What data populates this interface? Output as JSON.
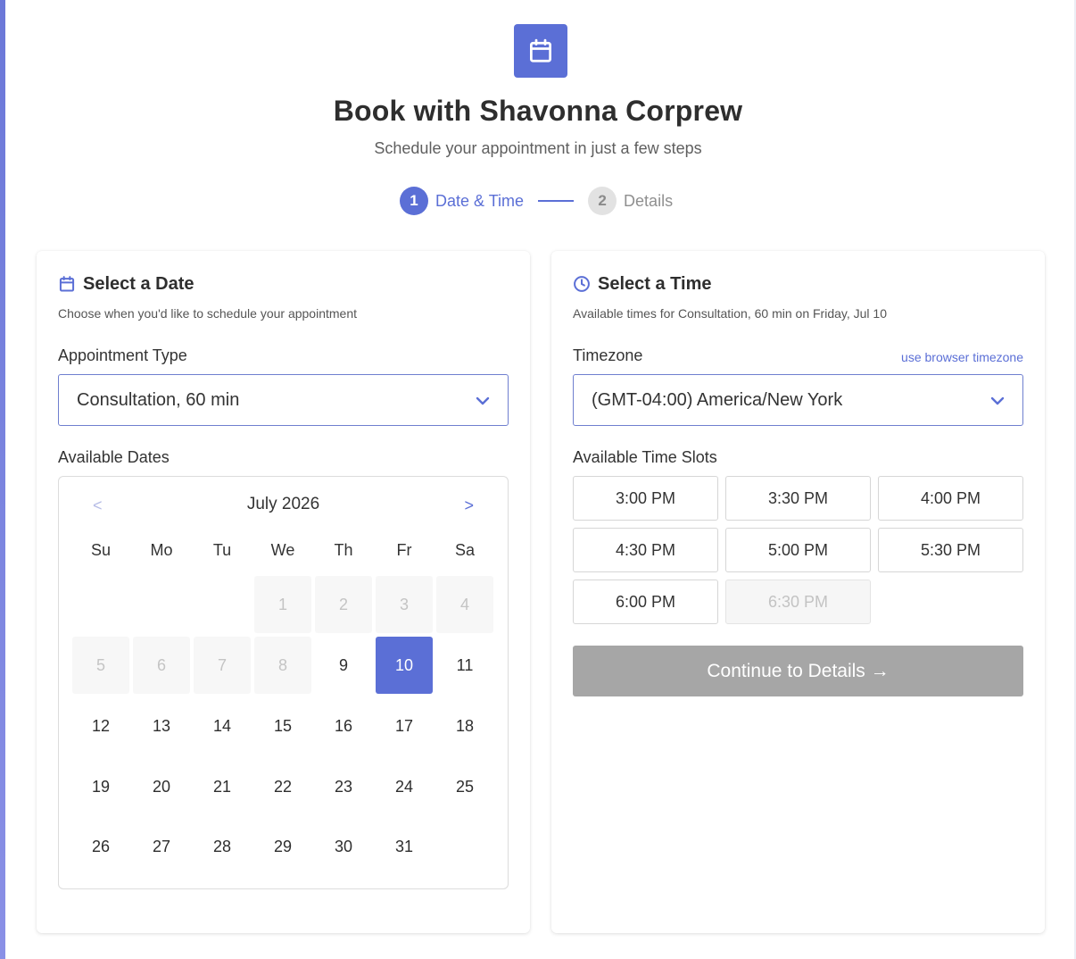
{
  "header": {
    "logo_icon": "calendar-icon",
    "title": "Book with Shavonna Corprew",
    "subtitle": "Schedule your appointment in just a few steps"
  },
  "steps": [
    {
      "number": "1",
      "label": "Date & Time",
      "state": "active"
    },
    {
      "number": "2",
      "label": "Details",
      "state": "inactive"
    }
  ],
  "date_card": {
    "title": "Select a Date",
    "description": "Choose when you'd like to schedule your appointment",
    "appointment_type_label": "Appointment Type",
    "appointment_type_value": "Consultation, 60 min",
    "available_dates_label": "Available Dates",
    "calendar": {
      "prev": "<",
      "next": ">",
      "month": "July 2026",
      "weekdays": [
        "Su",
        "Mo",
        "Tu",
        "We",
        "Th",
        "Fr",
        "Sa"
      ],
      "first_weekday_index": 3,
      "days_in_month": 31,
      "disabled_days": [
        1,
        2,
        3,
        4,
        5,
        6,
        7,
        8
      ],
      "selected_day": 10
    }
  },
  "time_card": {
    "title": "Select a Time",
    "description": "Available times for Consultation, 60 min on Friday, Jul 10",
    "timezone_label": "Timezone",
    "browser_timezone_link": "use browser timezone",
    "timezone_value": "(GMT-04:00) America/New York",
    "slots_label": "Available Time Slots",
    "slots": [
      {
        "time": "3:00 PM",
        "available": true
      },
      {
        "time": "3:30 PM",
        "available": true
      },
      {
        "time": "4:00 PM",
        "available": true
      },
      {
        "time": "4:30 PM",
        "available": true
      },
      {
        "time": "5:00 PM",
        "available": true
      },
      {
        "time": "5:30 PM",
        "available": true
      },
      {
        "time": "6:00 PM",
        "available": true
      },
      {
        "time": "6:30 PM",
        "available": false
      }
    ],
    "continue_label": "Continue to Details →"
  },
  "colors": {
    "accent": "#5b6fd6",
    "button_disabled": "#a6a6a6"
  }
}
